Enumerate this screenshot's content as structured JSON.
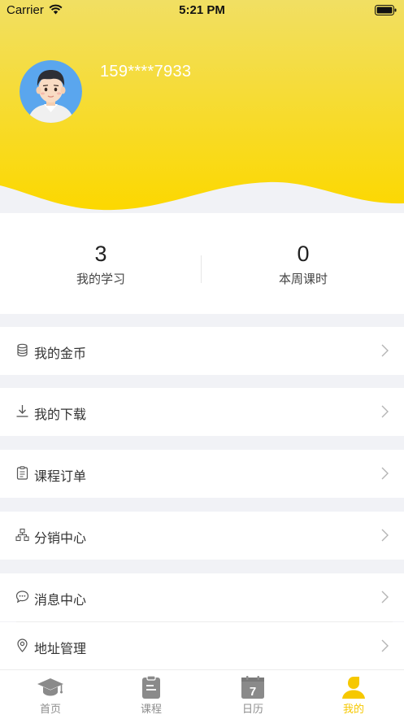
{
  "status_bar": {
    "carrier": "Carrier",
    "time": "5:21 PM"
  },
  "profile": {
    "phone": "159****7933"
  },
  "stats": [
    {
      "value": "3",
      "label": "我的学习"
    },
    {
      "value": "0",
      "label": "本周课时"
    }
  ],
  "menu": [
    {
      "label": "我的金币",
      "icon": "coins-icon"
    },
    {
      "label": "我的下载",
      "icon": "download-icon"
    },
    {
      "label": "课程订单",
      "icon": "order-icon"
    },
    {
      "label": "分销中心",
      "icon": "distribution-icon"
    },
    {
      "label": "消息中心",
      "icon": "message-icon"
    },
    {
      "label": "地址管理",
      "icon": "location-icon"
    }
  ],
  "tabs": [
    {
      "label": "首页",
      "icon": "graduation-cap-icon",
      "active": false
    },
    {
      "label": "课程",
      "icon": "clipboard-icon",
      "active": false
    },
    {
      "label": "日历",
      "icon": "calendar-icon",
      "active": false,
      "badge": "7"
    },
    {
      "label": "我的",
      "icon": "user-icon",
      "active": true
    }
  ],
  "colors": {
    "accent": "#f6c800",
    "header_top": "#f2df62",
    "header_bottom": "#fbd90a",
    "background": "#f1f2f6"
  }
}
